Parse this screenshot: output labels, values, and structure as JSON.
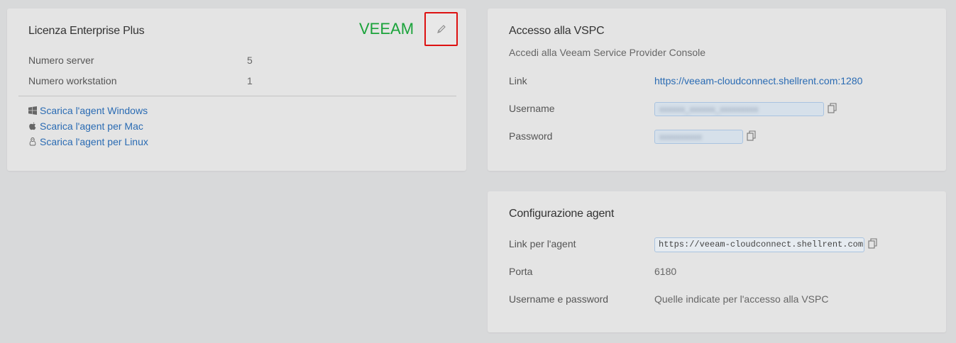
{
  "license": {
    "title": "Licenza Enterprise Plus",
    "logo_text": "VEEAM",
    "edit_icon": "pencil-icon",
    "rows": [
      {
        "label": "Numero server",
        "value": "5"
      },
      {
        "label": "Numero workstation",
        "value": "1"
      }
    ],
    "downloads": [
      {
        "icon": "windows-icon",
        "label": "Scarica l'agent Windows"
      },
      {
        "icon": "apple-icon",
        "label": "Scarica l'agent per Mac"
      },
      {
        "icon": "linux-icon",
        "label": "Scarica l'agent per Linux"
      }
    ]
  },
  "vspc": {
    "title": "Accesso alla VSPC",
    "subtitle": "Accedi alla Veeam Service Provider Console",
    "link_label": "Link",
    "link_value": "https://veeam-cloudconnect.shellrent.com:1280",
    "username_label": "Username",
    "username_value": "xxxxxx_xxxxxx_xxxxxxxxx",
    "password_label": "Password",
    "password_value": "xxxxxxxxxx"
  },
  "agent": {
    "title": "Configurazione agent",
    "link_label": "Link per l'agent",
    "link_value": "https://veeam-cloudconnect.shellrent.com",
    "port_label": "Porta",
    "port_value": "6180",
    "creds_label": "Username e password",
    "creds_value": "Quelle indicate per l'accesso alla VSPC"
  },
  "colors": {
    "accent_link": "#2a6bb3",
    "veeam_green": "#1aa33a",
    "highlight_red": "#dd1111"
  }
}
